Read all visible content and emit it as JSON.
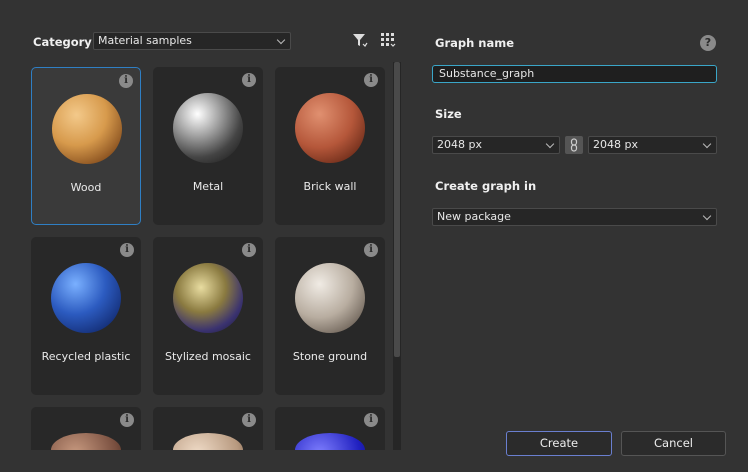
{
  "left": {
    "category_label": "Category",
    "category_value": "Material samples",
    "materials": [
      {
        "name": "Wood",
        "selected": true
      },
      {
        "name": "Metal"
      },
      {
        "name": "Brick wall"
      },
      {
        "name": "Recycled plastic"
      },
      {
        "name": "Stylized mosaic"
      },
      {
        "name": "Stone ground"
      },
      {
        "name": ""
      },
      {
        "name": ""
      },
      {
        "name": ""
      }
    ],
    "info_glyph": "i"
  },
  "right": {
    "graph_name_label": "Graph name",
    "help_glyph": "?",
    "graph_name_value": "Substance_graph",
    "size_label": "Size",
    "width_value": "2048 px",
    "height_value": "2048 px",
    "create_in_label": "Create graph in",
    "create_in_value": "New package"
  },
  "buttons": {
    "create": "Create",
    "cancel": "Cancel"
  },
  "colors": {
    "accent": "#2f7fc4",
    "input_focus": "#3aa6c8",
    "primary_border": "#6a7fd0"
  }
}
